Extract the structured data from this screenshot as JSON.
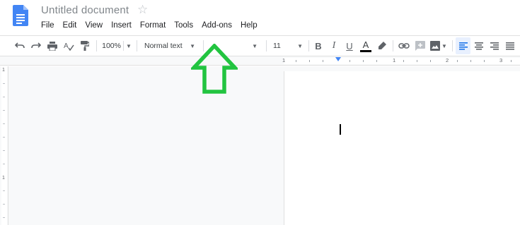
{
  "document": {
    "title": "Untitled document"
  },
  "menu": [
    "File",
    "Edit",
    "View",
    "Insert",
    "Format",
    "Tools",
    "Add-ons",
    "Help"
  ],
  "toolbar": {
    "zoom": "100%",
    "style": "Normal text",
    "font_size": "11",
    "bold_label": "B",
    "italic_label": "I",
    "underline_label": "U",
    "text_color_label": "A"
  },
  "ruler": {
    "labels": [
      "1",
      "1",
      "2",
      "3"
    ]
  },
  "vertical_ruler": {
    "labels": [
      "1",
      "1"
    ]
  },
  "colors": {
    "accent": "#4285f4",
    "arrow": "#22c440",
    "align_active": "#e8f0fe"
  },
  "icons": [
    "docs-logo-icon",
    "star-icon",
    "undo-icon",
    "redo-icon",
    "print-icon",
    "spellcheck-icon",
    "paint-format-icon",
    "chevron-down-icon",
    "link-icon",
    "comment-icon",
    "image-icon",
    "align-left-icon",
    "align-center-icon",
    "align-right-icon",
    "align-justify-icon",
    "highlighter-icon"
  ]
}
